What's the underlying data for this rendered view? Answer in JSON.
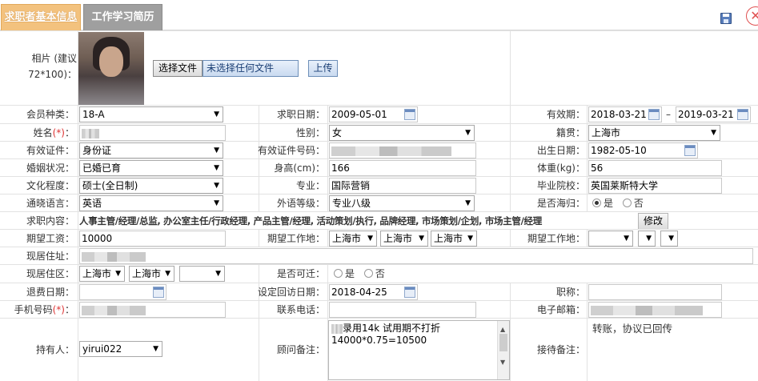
{
  "tabs": [
    {
      "label": "求职者基本信息",
      "active": true
    },
    {
      "label": "工作学习简历",
      "active": false
    }
  ],
  "photo": {
    "label": "相片 (建议72*100)：",
    "file_button": "选择文件",
    "file_status": "未选择任何文件",
    "upload_button": "上传"
  },
  "fields": {
    "member_type_label": "会员种类：",
    "member_type_value": "18-A",
    "job_date_label": "求职日期：",
    "job_date_value": "2009-05-01",
    "validity_label": "有效期：",
    "validity_from": "2018-03-21",
    "validity_sep": "–",
    "validity_to": "2019-03-21",
    "name_label": "姓名",
    "required_mark": "(*)",
    "gender_label": "性别：",
    "gender_value": "女",
    "native_label": "籍贯：",
    "native_value": "上海市",
    "id_type_label": "有效证件：",
    "id_type_value": "身份证",
    "id_no_label": "有效证件号码：",
    "birth_label": "出生日期：",
    "birth_value": "1982-05-10",
    "marital_label": "婚姻状况：",
    "marital_value": "已婚已育",
    "height_label": "身高(cm)：",
    "height_value": "166",
    "weight_label": "体重(kg)：",
    "weight_value": "56",
    "edu_label": "文化程度：",
    "edu_value": "硕士(全日制)",
    "major_label": "专业：",
    "major_value": "国际营销",
    "school_label": "毕业院校：",
    "school_value": "英国莱斯特大学",
    "lang_label": "通晓语言：",
    "lang_value": "英语",
    "lang_level_label": "外语等级：",
    "lang_level_value": "专业八级",
    "overseas_label": "是否海归：",
    "overseas_yes": "是",
    "overseas_no": "否",
    "job_content_label": "求职内容：",
    "job_content_value": "人事主管/经理/总监, 办公室主任/行政经理, 产品主管/经理, 活动策划/执行, 品牌经理, 市场策划/企划, 市场主管/经理",
    "modify_button": "修改",
    "salary_label": "期望工资：",
    "salary_value": "10000",
    "place1_label": "期望工作地：",
    "place1_a": "上海市",
    "place1_b": "上海市",
    "place1_c": "上海市",
    "place2_label": "期望工作地：",
    "address_label": "现居住址：",
    "district_label": "现居住区：",
    "district_a": "上海市",
    "district_b": "上海市",
    "relocate_label": "是否可迁：",
    "relocate_yes": "是",
    "relocate_no": "否",
    "refund_label": "退费日期：",
    "revisit_label": "设定回访日期：",
    "revisit_value": "2018-04-25",
    "title_label": "职称：",
    "mobile_label": "手机号码",
    "phone_label": "联系电话：",
    "email_label": "电子邮箱：",
    "holder_label": "持有人：",
    "holder_value": "yirui022",
    "advisor_note_label": "顾问备注：",
    "advisor_note_line1": "录用14k  试用期不打折",
    "advisor_note_line2": "14000*0.75=10500",
    "reception_note_label": "接待备注：",
    "reception_note_value": "转账，协议已回传"
  },
  "icons": {
    "save": "save-icon",
    "close": "close-icon",
    "calendar": "calendar-icon",
    "dropdown": "chevron-down-icon"
  }
}
